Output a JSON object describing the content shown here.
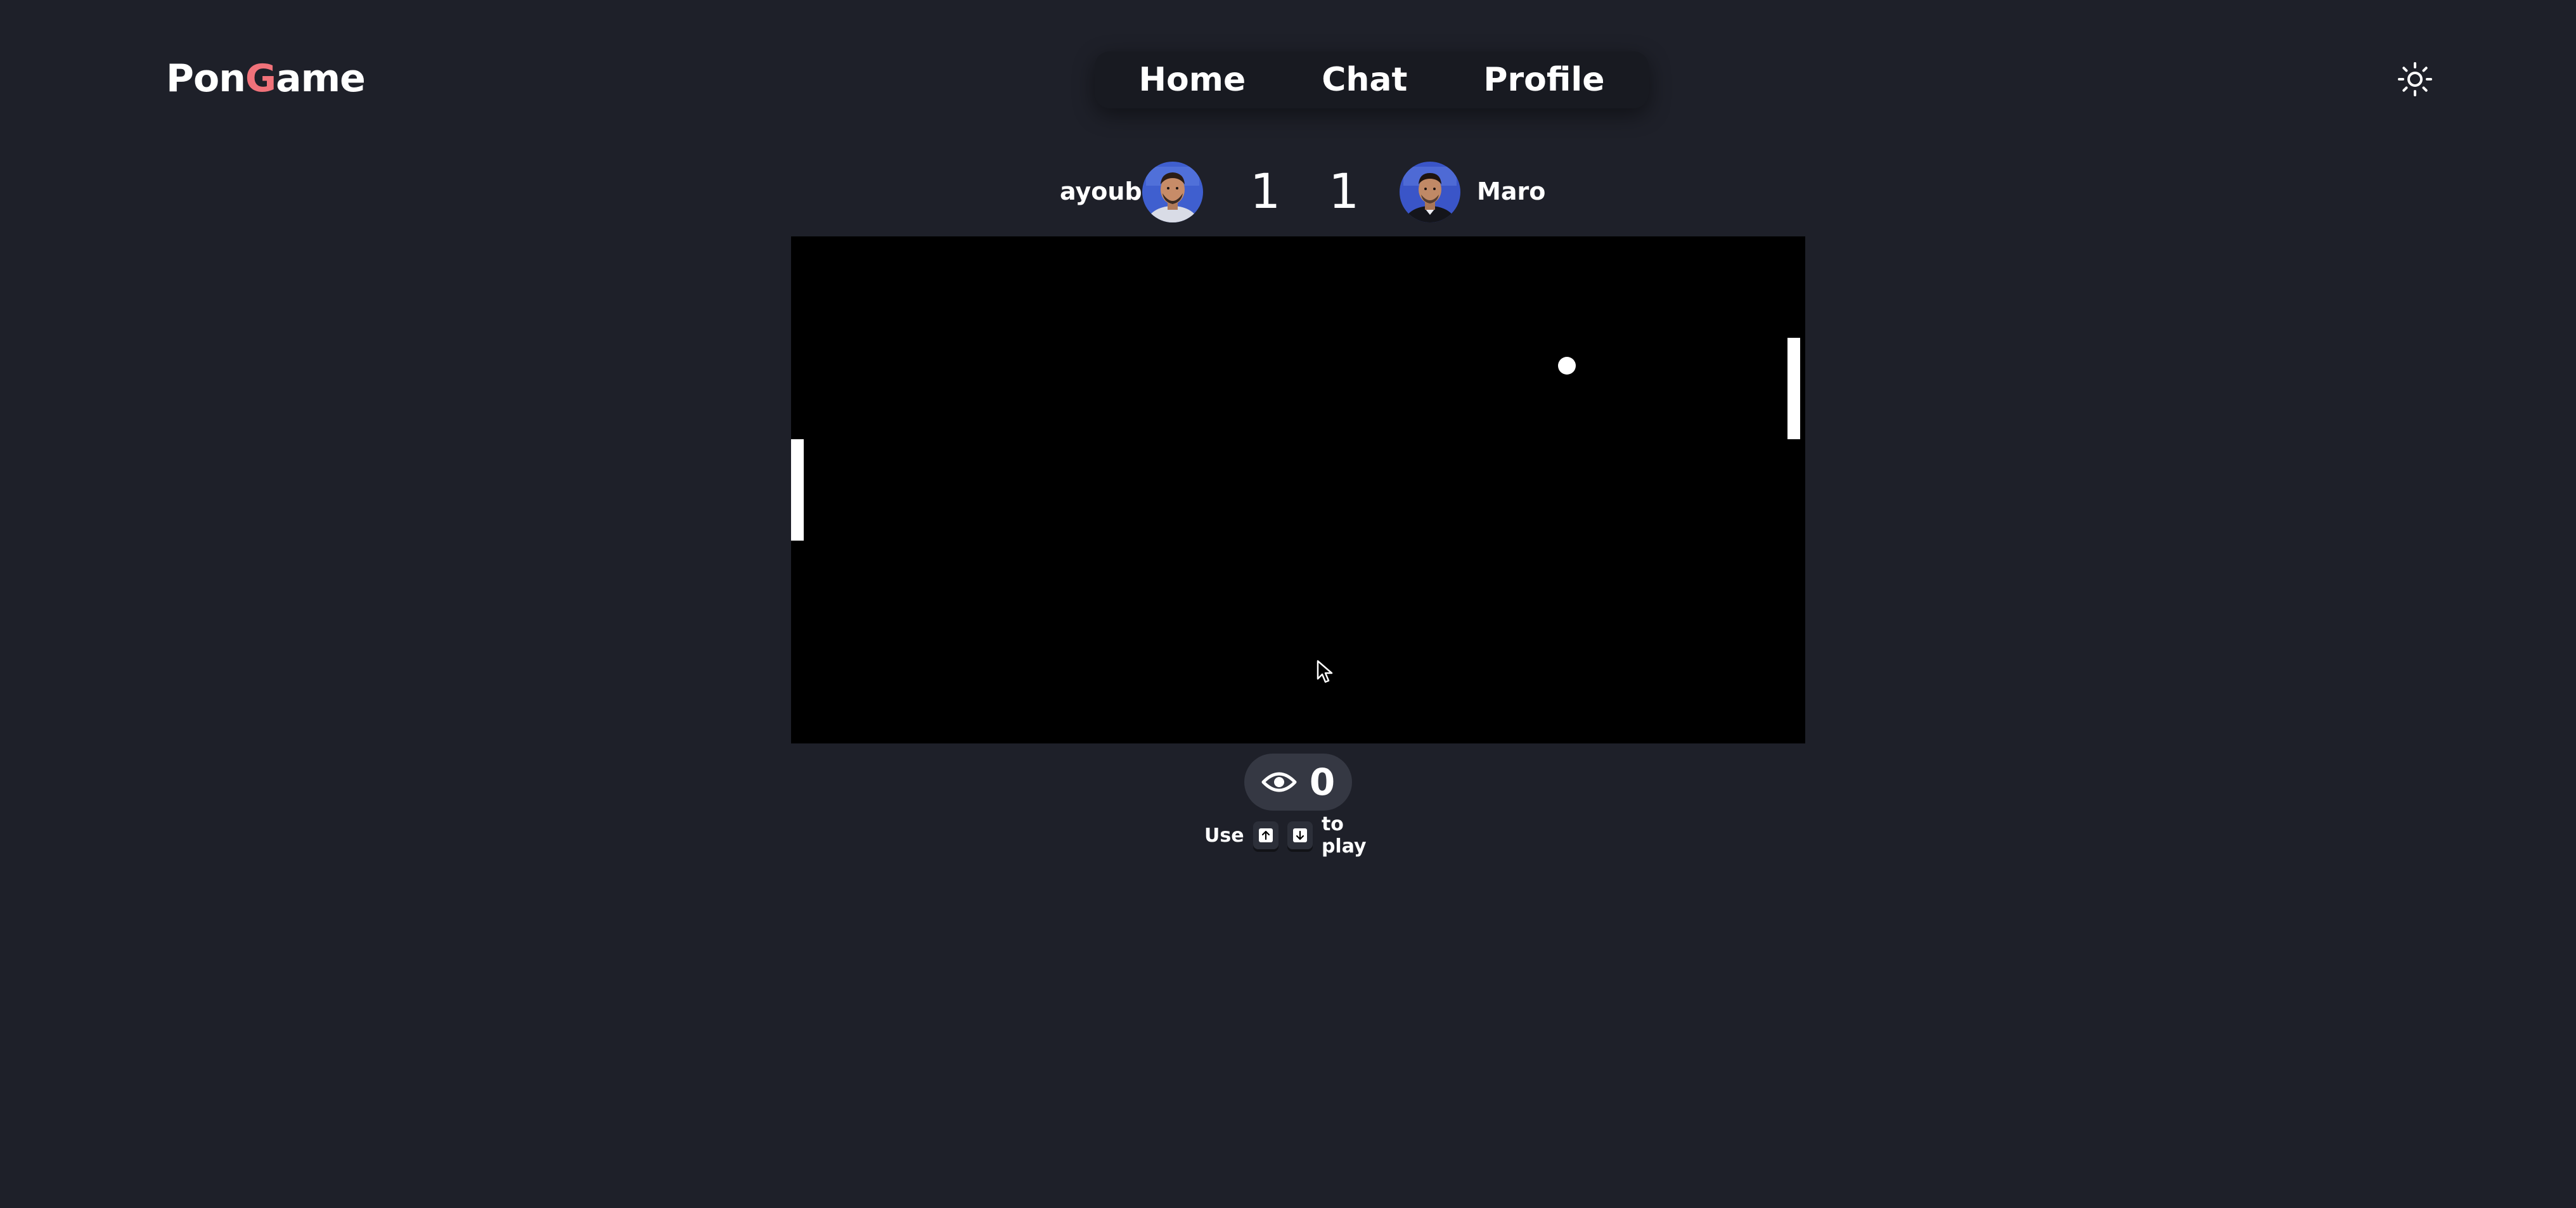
{
  "brand": {
    "logo_part1": "Pon",
    "logo_part2": "G",
    "logo_part3": "ame",
    "accent_color": "#f0727a"
  },
  "nav": {
    "items": [
      {
        "label": "Home"
      },
      {
        "label": "Chat"
      },
      {
        "label": "Profile"
      }
    ]
  },
  "theme_toggle": {
    "icon": "sun-icon"
  },
  "match": {
    "player_left": {
      "name": "ayoub",
      "score": "1",
      "avatar_icon": "avatar-photo"
    },
    "player_right": {
      "name": "Maro",
      "score": "1",
      "avatar_icon": "avatar-photo"
    }
  },
  "game": {
    "court_color": "#000000",
    "paddle_color": "#ffffff",
    "ball_color": "#ffffff"
  },
  "spectators": {
    "icon": "eye-icon",
    "count": "0"
  },
  "controls_hint": {
    "prefix": "Use",
    "up_key_icon": "arrow-up-icon",
    "down_key_icon": "arrow-down-icon",
    "suffix": "to play"
  },
  "colors": {
    "background": "#1e2029",
    "nav_background": "#181a21",
    "pill_background": "#353843"
  }
}
